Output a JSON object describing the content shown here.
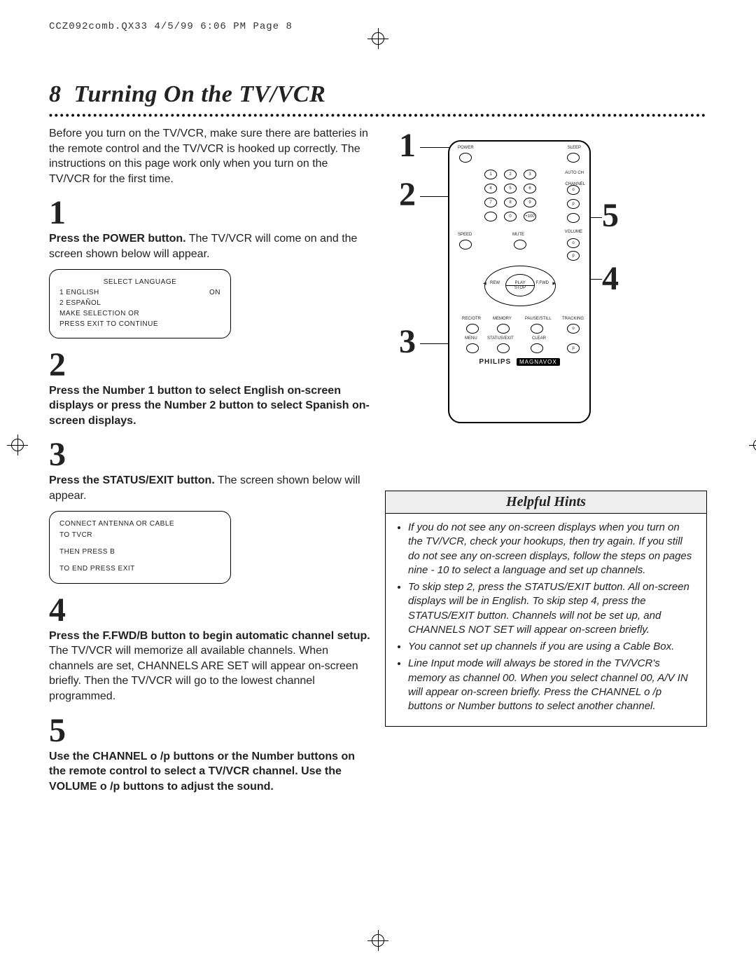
{
  "header": "CCZ092comb.QX33  4/5/99  6:06 PM  Page 8",
  "page_number": "8",
  "title": "Turning On the TV/VCR",
  "intro": "Before you turn on the TV/VCR, make sure there are batteries in the remote control and the TV/VCR is hooked up correctly. The instructions on this page work only when you turn on the TV/VCR for the first time.",
  "steps": {
    "s1": {
      "num": "1",
      "bold": "Press the POWER button.",
      "rest": " The TV/VCR will come on and the screen shown below will appear."
    },
    "screen1": {
      "line1": "SELECT LANGUAGE",
      "opt1": "1 ENGLISH",
      "opt1v": "ON",
      "opt2": "2 ESPAÑOL",
      "line4": "MAKE SELECTION OR",
      "line5": "PRESS EXIT TO CONTINUE"
    },
    "s2": {
      "num": "2",
      "bold": "Press the Number 1 button to select English on-screen displays or press the Number 2 button to select Spanish on-screen displays."
    },
    "s3": {
      "num": "3",
      "bold": "Press the STATUS/EXIT button.",
      "rest": " The screen shown below will appear."
    },
    "screen2": {
      "line1": "CONNECT ANTENNA OR CABLE",
      "line2": "TO TVCR",
      "line3": "THEN PRESS B",
      "line4": "TO END PRESS EXIT"
    },
    "s4": {
      "num": "4",
      "bold": "Press the F.FWD/B  button to begin automatic channel setup.",
      "rest": " The TV/VCR will memorize all available channels. When channels are set, CHANNELS ARE SET will appear on-screen briefly. Then the TV/VCR will go to the lowest channel programmed."
    },
    "s5": {
      "num": "5",
      "bold": "Use the CHANNEL o /p  buttons or the Number buttons on the remote control to select a TV/VCR channel. Use the VOLUME o /p buttons to adjust the sound."
    }
  },
  "remote": {
    "labels": {
      "power": "POWER",
      "sleep": "SLEEP",
      "autoch": "AUTO CH",
      "channel": "CHANNEL",
      "speed": "SPEED",
      "mute": "MUTE",
      "volume": "VOLUME",
      "play": "PLAY",
      "rew": "REW",
      "ffwd": "F.FWD",
      "stop": "STOP",
      "recotr": "REC/OTR",
      "memory": "MEMORY",
      "pausestill": "PAUSE/STILL",
      "menu": "MENU",
      "statusexit": "STATUS/EXIT",
      "clear": "CLEAR",
      "tracking": "TRACKING"
    },
    "callouts": {
      "c1": "1",
      "c2": "2",
      "c3": "3",
      "c4": "4",
      "c5": "5"
    },
    "brand": "PHILIPS",
    "brand2": "MAGNAVOX"
  },
  "hints": {
    "title": "Helpful Hints",
    "items": [
      "If you do not see any on-screen displays when you turn on the TV/VCR, check your hookups, then try again. If you still do not see any on-screen displays, follow the steps on pages nine - 10 to select a language and set up channels.",
      "To skip step 2, press the STATUS/EXIT button. All on-screen displays will be in English. To skip step 4, press the STATUS/EXIT button. Channels will not be set up, and CHANNELS NOT SET will appear on-screen briefly.",
      "You cannot set up channels if you are using a Cable Box.",
      "Line Input mode will always be stored in the TV/VCR's memory as channel 00. When you select channel 00, A/V IN will appear on-screen briefly. Press the CHANNEL o /p  buttons or Number buttons to select another channel."
    ]
  }
}
